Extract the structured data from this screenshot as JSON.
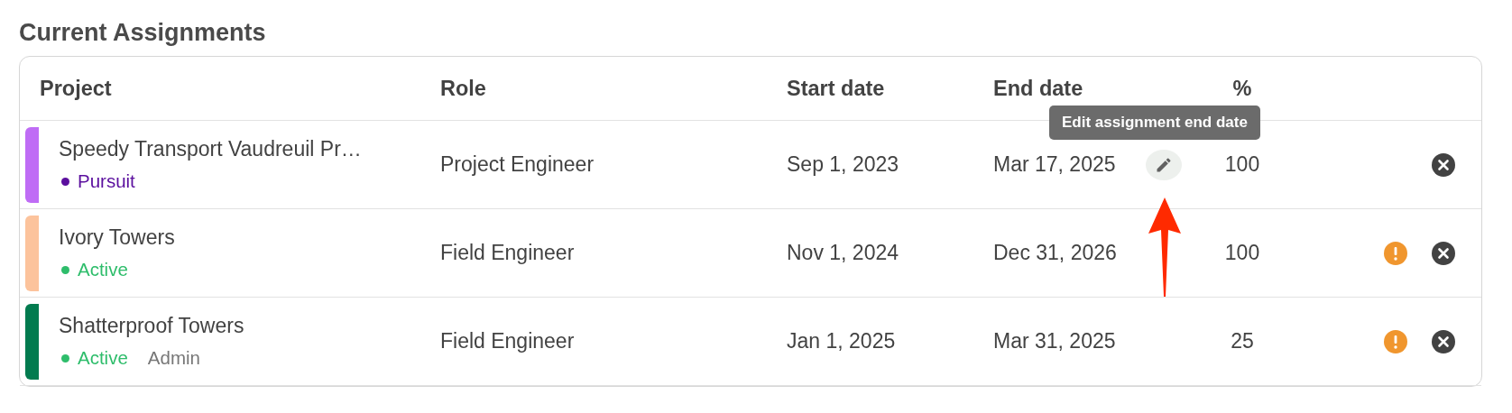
{
  "section": {
    "title": "Current Assignments"
  },
  "table": {
    "columns": [
      "Project",
      "Role",
      "Start date",
      "End date",
      "%"
    ],
    "rows": [
      {
        "project": "Speedy Transport Vaudreuil Pr…",
        "color": "#bf6cf5",
        "status": {
          "label": "Pursuit",
          "color": "#5b0f9e"
        },
        "role": "Project Engineer",
        "start": "Sep 1, 2023",
        "end": "Mar 17, 2025",
        "edit_hovered": true,
        "percent": "100",
        "warning": false
      },
      {
        "project": "Ivory Towers",
        "color": "#fcc39c",
        "status": {
          "label": "Active",
          "color": "#2ebd6b"
        },
        "role": "Field Engineer",
        "start": "Nov 1, 2024",
        "end": "Dec 31, 2026",
        "edit_hovered": false,
        "percent": "100",
        "warning": true
      },
      {
        "project": "Shatterproof Towers",
        "color": "#027b4f",
        "status": {
          "label": "Active",
          "color": "#2ebd6b"
        },
        "tag": "Admin",
        "role": "Field Engineer",
        "start": "Jan 1, 2025",
        "end": "Mar 31, 2025",
        "edit_hovered": false,
        "percent": "25",
        "warning": true
      }
    ]
  },
  "tooltip": {
    "text": "Edit assignment end date"
  }
}
